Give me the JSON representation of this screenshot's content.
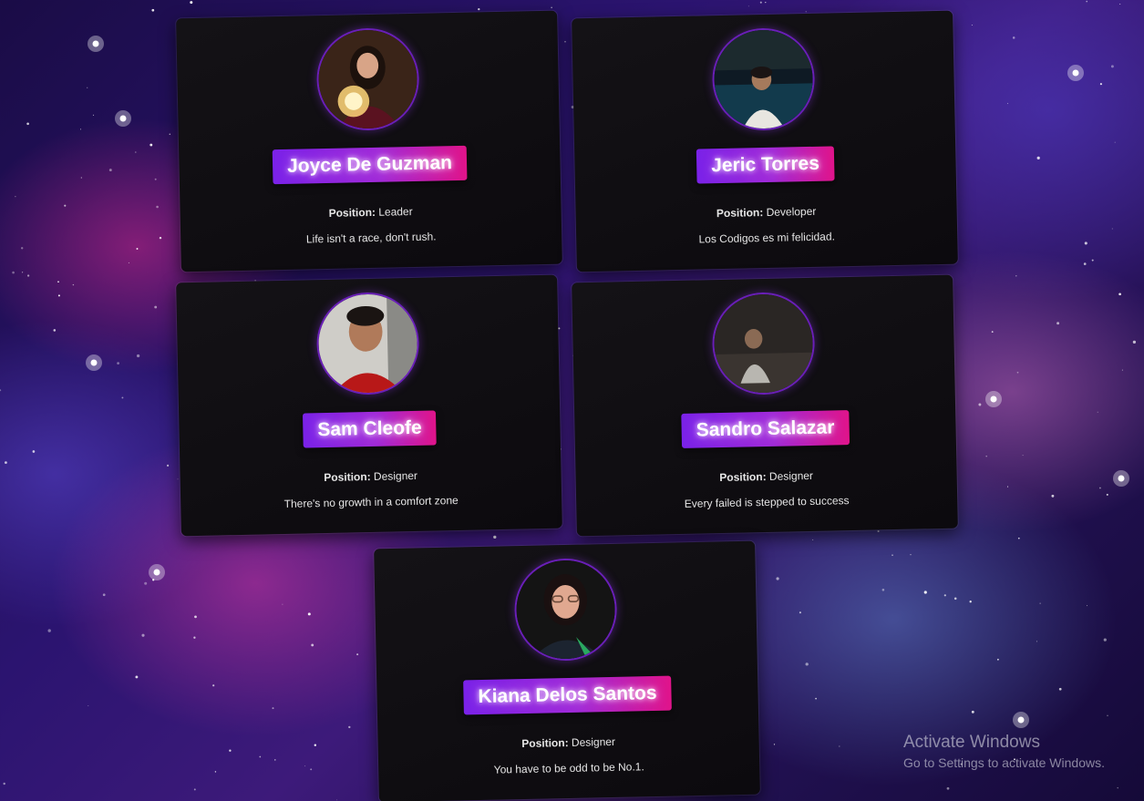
{
  "members": [
    {
      "name": "Joyce De Guzman",
      "position_label": "Position:",
      "position": "Leader",
      "quote": "Life isn't a race, don't rush."
    },
    {
      "name": "Jeric Torres",
      "position_label": "Position:",
      "position": "Developer",
      "quote": "Los Codigos es mi felicidad."
    },
    {
      "name": "Sam Cleofe",
      "position_label": "Position:",
      "position": "Designer",
      "quote": "There's no growth in a comfort zone"
    },
    {
      "name": "Sandro Salazar",
      "position_label": "Position:",
      "position": "Designer",
      "quote": "Every failed is stepped to success"
    },
    {
      "name": "Kiana Delos Santos",
      "position_label": "Position:",
      "position": "Designer",
      "quote": "You have to be odd to be No.1."
    }
  ],
  "watermark": {
    "title": "Activate Windows",
    "subtitle": "Go to Settings to activate Windows."
  },
  "colors": {
    "badge_start": "#7a22e8",
    "badge_end": "#e0148a",
    "card_bg": "#0c0a0e",
    "avatar_border": "#6a1fb8"
  }
}
